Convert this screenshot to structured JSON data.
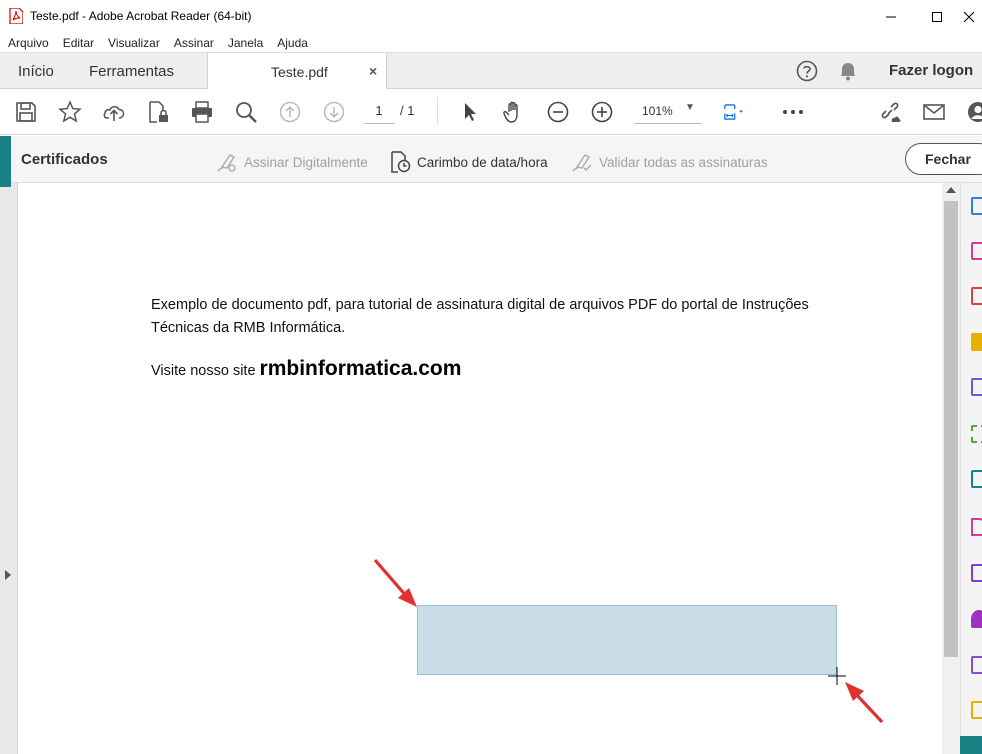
{
  "window": {
    "title": "Teste.pdf - Adobe Acrobat Reader (64-bit)"
  },
  "menu": [
    "Arquivo",
    "Editar",
    "Visualizar",
    "Assinar",
    "Janela",
    "Ajuda"
  ],
  "tabs": {
    "home": "Início",
    "tools": "Ferramentas",
    "document": "Teste.pdf",
    "close_symbol": "×",
    "login": "Fazer logon"
  },
  "toolbar": {
    "page_current": "1",
    "page_total": "/ 1",
    "zoom": "101%"
  },
  "certificates": {
    "title": "Certificados",
    "sign_digitally": "Assinar Digitalmente",
    "timestamp": "Carimbo de data/hora",
    "validate_all": "Validar todas as assinaturas",
    "close_button": "Fechar"
  },
  "document": {
    "paragraph1": "Exemplo de documento pdf, para tutorial de assinatura digital de arquivos PDF do portal de Instruções Técnicas da RMB Informática.",
    "visit_prefix": "Visite nosso site ",
    "site": "rmbinformatica.com"
  },
  "colors": {
    "accent": "#198287",
    "selection_fill": "#c9dde9",
    "annotation_arrow": "#e03030"
  },
  "right_tools_icons": [
    "export-pdf-icon",
    "organize-pages-icon",
    "create-pdf-icon",
    "comment-icon",
    "combine-files-icon",
    "compress-icon",
    "edit-pdf-icon",
    "fill-sign-icon",
    "protect-icon",
    "send-for-signature-icon",
    "sign-icon",
    "stamp-icon"
  ]
}
